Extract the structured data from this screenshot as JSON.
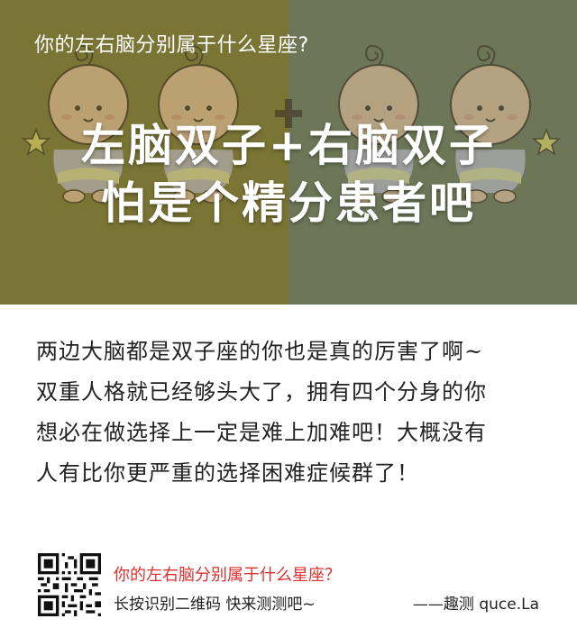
{
  "colors": {
    "hero_left": "#7a7535",
    "hero_right": "#6d7758",
    "footer_question": "#e03030"
  },
  "hero": {
    "question": "你的左右脑分别属于什么星座?",
    "headline_line1": "左脑双子+右脑双子",
    "headline_line2": "怕是个精分患者吧",
    "illustration": "twin-babies-icon"
  },
  "body": {
    "lines": [
      "两边大脑都是双子座的你也是真的厉害了啊~",
      "双重人格就已经够头大了，拥有四个分身的你",
      "想必在做选择上一定是难上加难吧！大概没有",
      "人有比你更严重的选择困难症候群了！"
    ]
  },
  "footer": {
    "qr_icon": "qr-code-icon",
    "question": "你的左右脑分别属于什么星座？",
    "hint": "长按识别二维码  快来测测吧~",
    "brand": "——趣测 quce.La"
  }
}
